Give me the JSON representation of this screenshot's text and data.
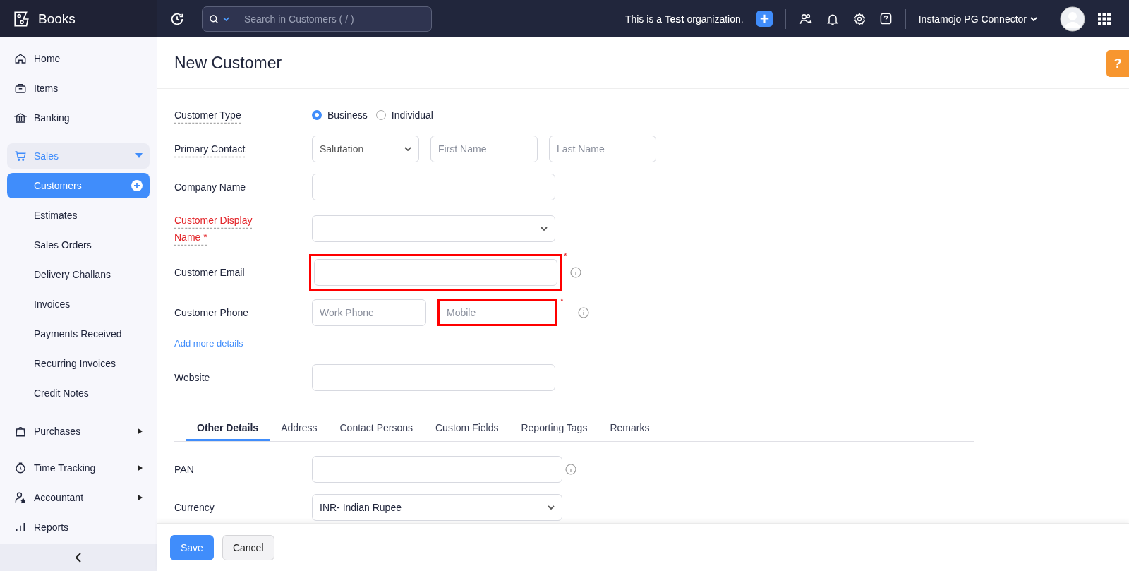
{
  "topbar": {
    "app_name": "Books",
    "search": {
      "placeholder": "Search in Customers ( / )"
    },
    "org_notice": "This is a **Test** organization.",
    "org_name": "Instamojo PG Connector"
  },
  "sidebar": {
    "items": [
      {
        "label": "Home",
        "kind": "link",
        "selected": false
      },
      {
        "label": "Items",
        "kind": "link",
        "selected": false
      },
      {
        "label": "Banking",
        "kind": "link",
        "selected": false
      },
      {
        "label": "Sales",
        "kind": "group",
        "expanded": true,
        "selected": false,
        "children": [
          {
            "label": "Customers",
            "selected": true
          },
          {
            "label": "Estimates",
            "selected": false
          },
          {
            "label": "Sales Orders",
            "selected": false
          },
          {
            "label": "Delivery Challans",
            "selected": false
          },
          {
            "label": "Invoices",
            "selected": false
          },
          {
            "label": "Payments Received",
            "selected": false
          },
          {
            "label": "Recurring Invoices",
            "selected": false
          },
          {
            "label": "Credit Notes",
            "selected": false
          }
        ]
      },
      {
        "label": "Purchases",
        "kind": "group",
        "expanded": false,
        "selected": false
      },
      {
        "label": "Time Tracking",
        "kind": "group",
        "expanded": false,
        "selected": false
      },
      {
        "label": "Accountant",
        "kind": "group",
        "expanded": false,
        "selected": false
      },
      {
        "label": "Reports",
        "kind": "link",
        "selected": false
      }
    ]
  },
  "page": {
    "title": "New Customer",
    "help": "?"
  },
  "form": {
    "customer_type": {
      "label": "Customer Type",
      "options": [
        {
          "label": "Business",
          "selected": true
        },
        {
          "label": "Individual",
          "selected": false
        }
      ]
    },
    "primary_contact": {
      "label": "Primary Contact",
      "salutation": "Salutation",
      "first_name": {
        "placeholder": "First Name"
      },
      "last_name": {
        "placeholder": "Last Name"
      }
    },
    "company_name": {
      "label": "Company Name"
    },
    "display_name": {
      "label": "Customer Display Name *"
    },
    "email": {
      "label": "Customer Email",
      "highlighted": true,
      "required_mark": "*"
    },
    "phone": {
      "label": "Customer Phone",
      "work": {
        "placeholder": "Work Phone"
      },
      "mobile": {
        "placeholder": "Mobile",
        "highlighted": true,
        "required_mark": "*"
      }
    },
    "add_more": "Add more details",
    "website": {
      "label": "Website"
    }
  },
  "tabs": [
    {
      "label": "Other Details",
      "selected": true
    },
    {
      "label": "Address",
      "selected": false
    },
    {
      "label": "Contact Persons",
      "selected": false
    },
    {
      "label": "Custom Fields",
      "selected": false
    },
    {
      "label": "Reporting Tags",
      "selected": false
    },
    {
      "label": "Remarks",
      "selected": false
    }
  ],
  "other_details": {
    "pan": {
      "label": "PAN"
    },
    "currency": {
      "label": "Currency",
      "value": "INR- Indian Rupee"
    }
  },
  "footer": {
    "buttons": [
      {
        "label": "Save",
        "kind": "primary"
      },
      {
        "label": "Cancel",
        "kind": "secondary"
      }
    ]
  }
}
